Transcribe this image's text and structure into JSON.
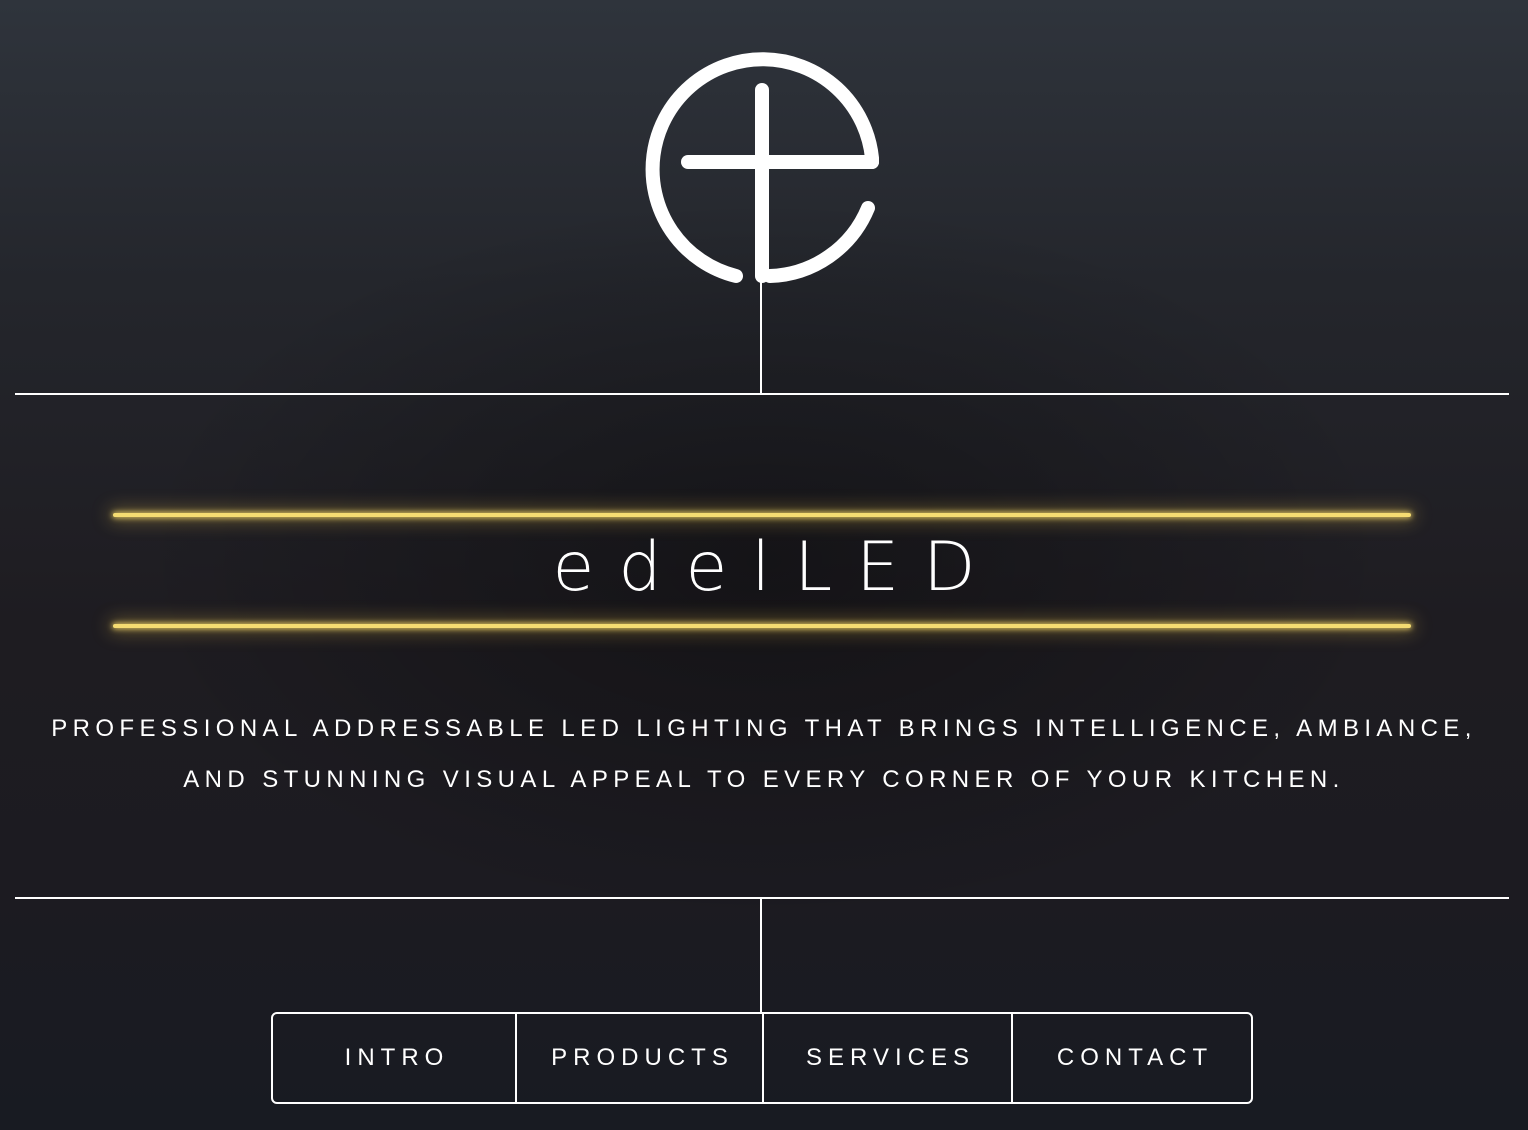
{
  "brand": {
    "logo": "edelled-e-plus-logo-icon",
    "name": "edelLED",
    "accent_color": "#f5dc72"
  },
  "tagline": {
    "line1": "PROFESSIONAL ADDRESSABLE LED LIGHTING THAT BRINGS INTELLIGENCE, AMBIANCE,",
    "line2": "AND STUNNING VISUAL APPEAL TO EVERY CORNER OF YOUR KITCHEN."
  },
  "nav": {
    "items": [
      {
        "label": "INTRO"
      },
      {
        "label": "PRODUCTS"
      },
      {
        "label": "SERVICES"
      },
      {
        "label": "CONTACT"
      }
    ]
  }
}
